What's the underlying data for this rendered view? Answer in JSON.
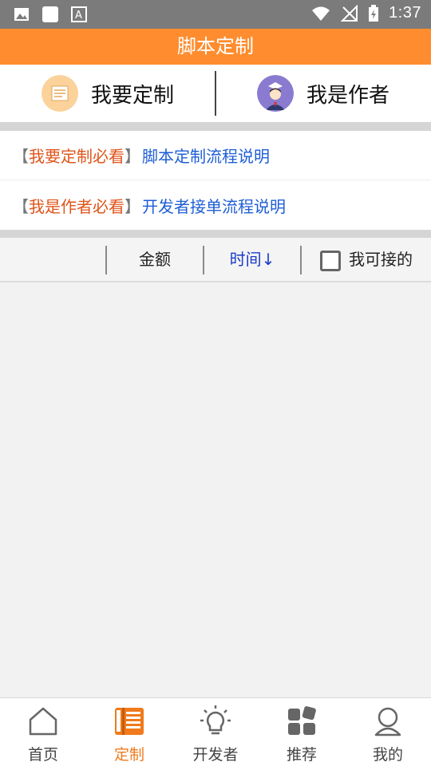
{
  "status_bar": {
    "time": "1:37",
    "left_icons": [
      "image-icon",
      "square-icon",
      "font-icon"
    ],
    "right_icons": [
      "wifi-icon",
      "no-signal-icon",
      "battery-charging-icon"
    ]
  },
  "header": {
    "title": "脚本定制"
  },
  "choose": {
    "customize_label": "我要定制",
    "author_label": "我是作者"
  },
  "links": [
    {
      "open": "【",
      "tag": "我要定制必看",
      "close": "】",
      "desc": "脚本定制流程说明"
    },
    {
      "open": "【",
      "tag": "我是作者必看",
      "close": "】",
      "desc": "开发者接单流程说明"
    }
  ],
  "filter": {
    "amount_label": "金额",
    "time_label": "时间↓",
    "acceptable_label": "我可接的"
  },
  "bottom_nav": [
    {
      "label": "首页",
      "icon": "home-icon"
    },
    {
      "label": "定制",
      "icon": "book-icon"
    },
    {
      "label": "开发者",
      "icon": "lightbulb-icon"
    },
    {
      "label": "推荐",
      "icon": "grid-icon"
    },
    {
      "label": "我的",
      "icon": "user-icon"
    }
  ],
  "colors": {
    "accent": "#ff8d2f",
    "tag": "#e0541a",
    "link": "#1e5ed6",
    "time_sort": "#1a3cc8"
  }
}
